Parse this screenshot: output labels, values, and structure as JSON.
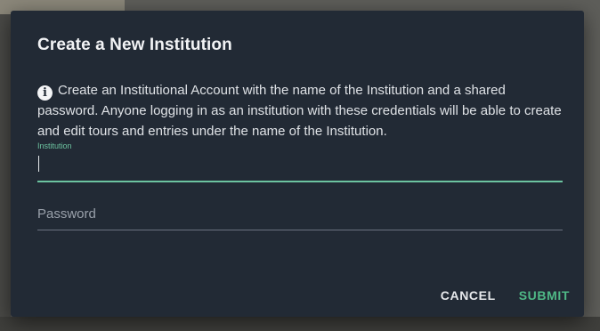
{
  "dialog": {
    "title": "Create a New Institution",
    "info_icon": "info-icon",
    "info_text": "Create an Institutional Account with the name of the Institution and a shared password. Anyone logging in as an institution with these credentials will be able to create and edit tours and entries under the name of the Institution."
  },
  "form": {
    "institution": {
      "label": "Institution",
      "value": ""
    },
    "password": {
      "placeholder": "Password",
      "value": ""
    }
  },
  "actions": {
    "cancel_label": "CANCEL",
    "submit_label": "SUBMIT"
  },
  "colors": {
    "dialog_bg": "#222a35",
    "accent": "#4fb886",
    "focus_underline": "#6cc3a0"
  }
}
